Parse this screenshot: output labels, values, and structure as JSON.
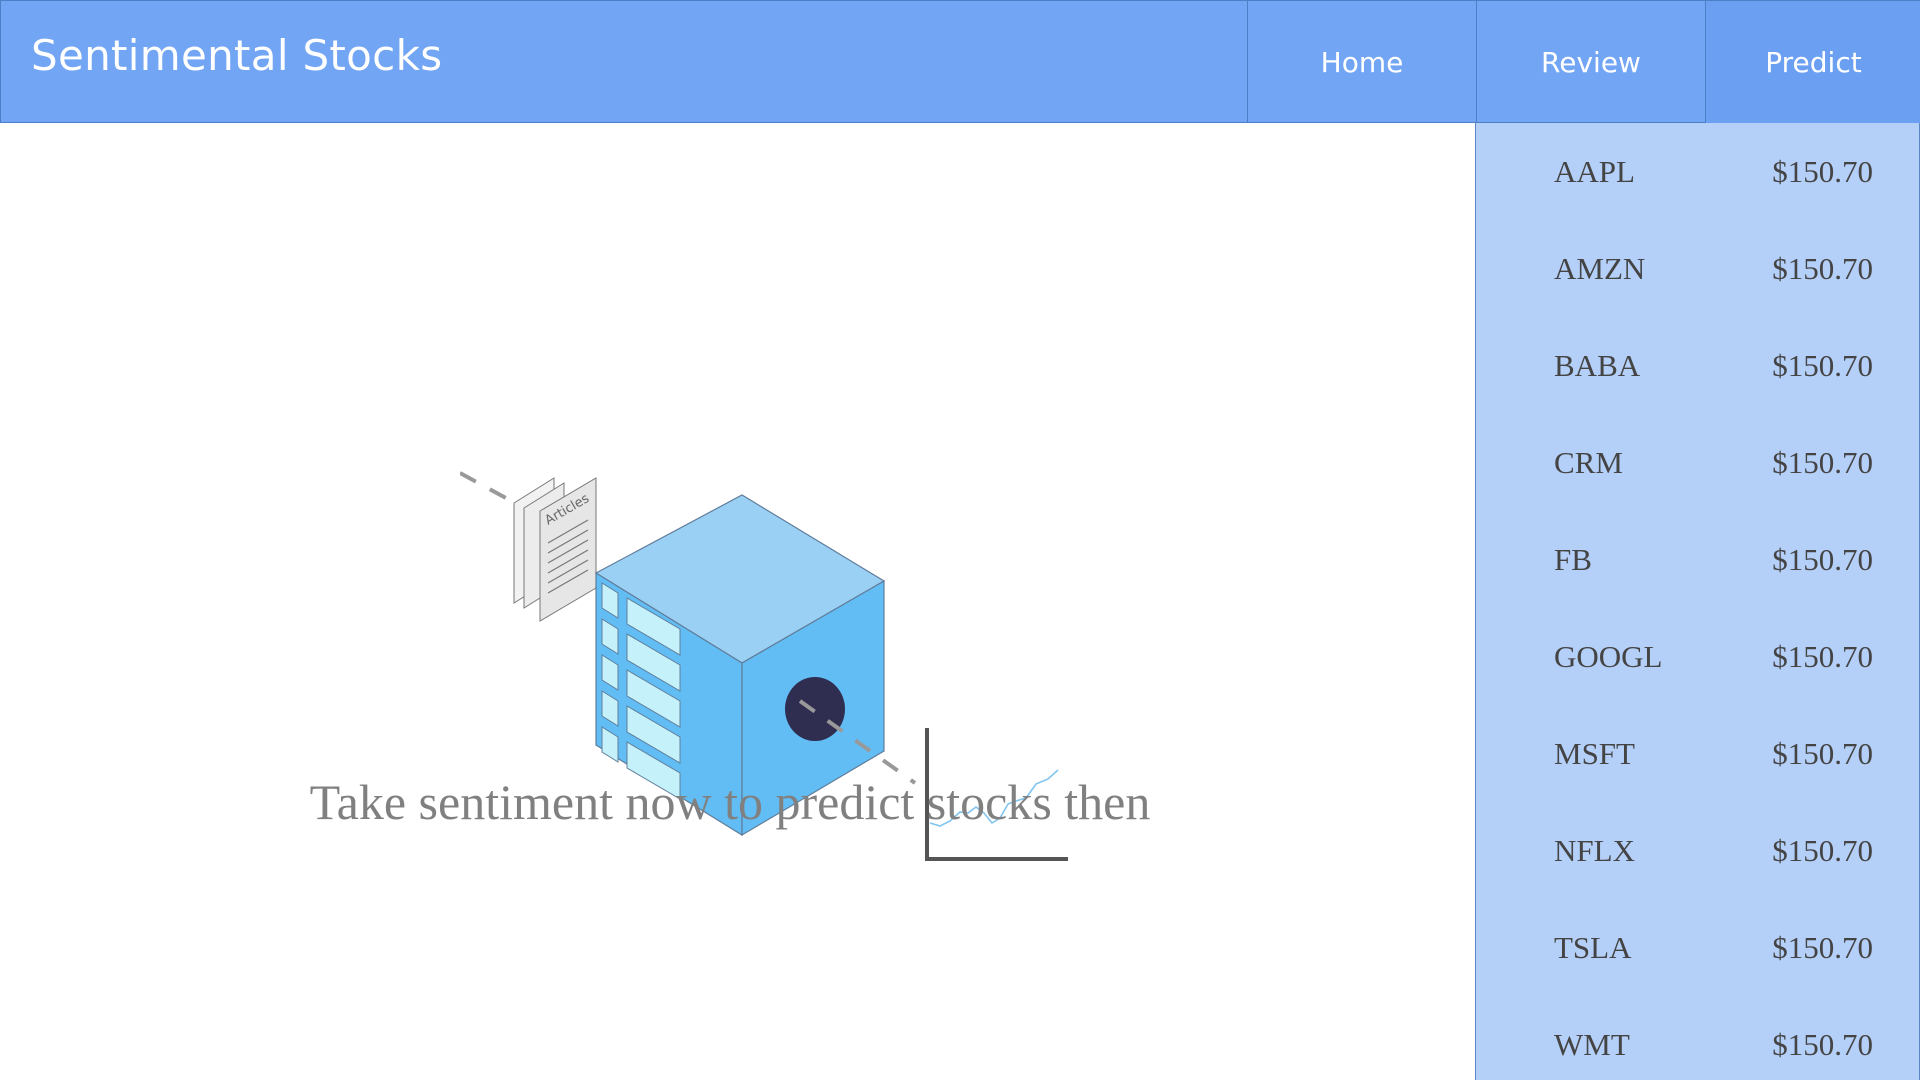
{
  "header": {
    "brand": "Sentimental Stocks",
    "nav": [
      {
        "label": "Home"
      },
      {
        "label": "Review"
      },
      {
        "label": "Predict"
      }
    ]
  },
  "hero": {
    "article_label": "Articles",
    "tagline": "Take sentiment now to predict stocks then"
  },
  "tickers": [
    {
      "symbol": "AAPL",
      "price": "$150.70"
    },
    {
      "symbol": "AMZN",
      "price": "$150.70"
    },
    {
      "symbol": "BABA",
      "price": "$150.70"
    },
    {
      "symbol": "CRM",
      "price": "$150.70"
    },
    {
      "symbol": "FB",
      "price": "$150.70"
    },
    {
      "symbol": "GOOGL",
      "price": "$150.70"
    },
    {
      "symbol": "MSFT",
      "price": "$150.70"
    },
    {
      "symbol": "NFLX",
      "price": "$150.70"
    },
    {
      "symbol": "TSLA",
      "price": "$150.70"
    },
    {
      "symbol": "WMT",
      "price": "$150.70"
    }
  ],
  "colors": {
    "header": "#72a5f3",
    "sidebar": "#b4cff8",
    "cube_top": "#9bd0f5",
    "cube_side": "#62bdf4",
    "lens": "#2f2d50"
  }
}
